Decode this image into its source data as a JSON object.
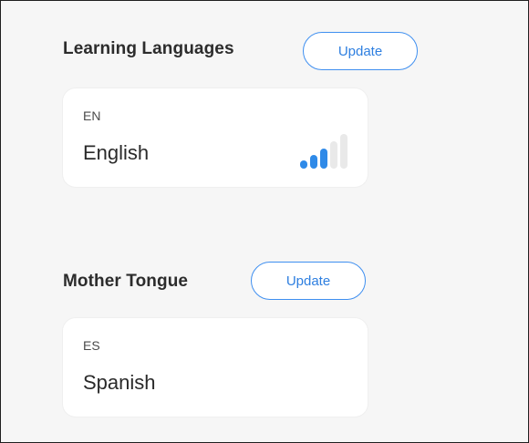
{
  "learning": {
    "title": "Learning Languages",
    "update_label": "Update",
    "languages": [
      {
        "code": "EN",
        "name": "English",
        "proficiency_level": 3,
        "proficiency_max": 5,
        "level_color": "#2f8ae8"
      }
    ]
  },
  "mother_tongue": {
    "title": "Mother Tongue",
    "update_label": "Update",
    "languages": [
      {
        "code": "ES",
        "name": "Spanish"
      }
    ]
  },
  "colors": {
    "accent": "#2e7fe0",
    "card_background": "#ffffff",
    "page_background": "#f6f6f6"
  }
}
